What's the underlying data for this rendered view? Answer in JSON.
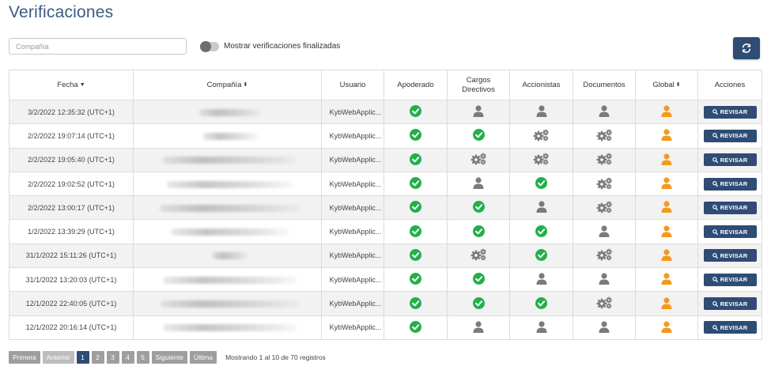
{
  "page": {
    "title": "Verificaciones"
  },
  "filters": {
    "search_placeholder": "Compañía",
    "search_value": "",
    "toggle_label": "Mostrar verificaciones finalizadas",
    "toggle_on": false
  },
  "colors": {
    "brand": "#2e4c74",
    "success": "#21b04b",
    "warning": "#f39a1e",
    "neutral": "#7b7b7b"
  },
  "table": {
    "columns": {
      "fecha": "Fecha",
      "compania": "Compañía",
      "usuario": "Usuario",
      "apoderado": "Apoderado",
      "cargos": "Cargos Directivos",
      "accionistas": "Accionistas",
      "documentos": "Documentos",
      "global": "Global",
      "acciones": "Acciones"
    },
    "rows": [
      {
        "fecha": "3/2/2022 12:35:32 (UTC+1)",
        "usuario": "KybWebApplic...",
        "apoderado": "check",
        "cargos": "person",
        "accionistas": "person",
        "documentos": "person",
        "global": "person-warning",
        "accion": "REVISAR"
      },
      {
        "fecha": "2/2/2022 19:07:14 (UTC+1)",
        "usuario": "KybWebApplic...",
        "apoderado": "check",
        "cargos": "check",
        "accionistas": "gears",
        "documentos": "gears",
        "global": "person-warning",
        "accion": "REVISAR"
      },
      {
        "fecha": "2/2/2022 19:05:40 (UTC+1)",
        "usuario": "KybWebApplic...",
        "apoderado": "check",
        "cargos": "gears",
        "accionistas": "gears",
        "documentos": "gears",
        "global": "person-warning",
        "accion": "REVISAR"
      },
      {
        "fecha": "2/2/2022 19:02:52 (UTC+1)",
        "usuario": "KybWebApplic...",
        "apoderado": "check",
        "cargos": "person",
        "accionistas": "check",
        "documentos": "gears",
        "global": "person-warning",
        "accion": "REVISAR"
      },
      {
        "fecha": "2/2/2022 13:00:17 (UTC+1)",
        "usuario": "KybWebApplic...",
        "apoderado": "check",
        "cargos": "check",
        "accionistas": "person",
        "documentos": "gears",
        "global": "person-warning",
        "accion": "REVISAR"
      },
      {
        "fecha": "1/2/2022 13:39:29 (UTC+1)",
        "usuario": "KybWebApplic...",
        "apoderado": "check",
        "cargos": "check",
        "accionistas": "check",
        "documentos": "person",
        "global": "person-warning",
        "accion": "REVISAR"
      },
      {
        "fecha": "31/1/2022 15:11:26 (UTC+1)",
        "usuario": "KybWebApplic...",
        "apoderado": "check",
        "cargos": "gears",
        "accionistas": "check",
        "documentos": "gears",
        "global": "person-warning",
        "accion": "REVISAR"
      },
      {
        "fecha": "31/1/2022 13:20:03 (UTC+1)",
        "usuario": "KybWebApplic...",
        "apoderado": "check",
        "cargos": "check",
        "accionistas": "person",
        "documentos": "person",
        "global": "person-warning",
        "accion": "REVISAR"
      },
      {
        "fecha": "12/1/2022 22:40:05 (UTC+1)",
        "usuario": "KybWebApplic...",
        "apoderado": "check",
        "cargos": "check",
        "accionistas": "check",
        "documentos": "gears",
        "global": "person-warning",
        "accion": "REVISAR"
      },
      {
        "fecha": "12/1/2022 20:16:14 (UTC+1)",
        "usuario": "KybWebApplic...",
        "apoderado": "check",
        "cargos": "person",
        "accionistas": "person",
        "documentos": "person",
        "global": "person-warning",
        "accion": "REVISAR"
      }
    ]
  },
  "pagination": {
    "first": "Primera",
    "prev": "Anterior",
    "pages": [
      "1",
      "2",
      "3",
      "4",
      "5"
    ],
    "active_page": "1",
    "next": "Siguiente",
    "last": "Última",
    "info": "Mostrando 1 al 10 de 70 registros"
  }
}
